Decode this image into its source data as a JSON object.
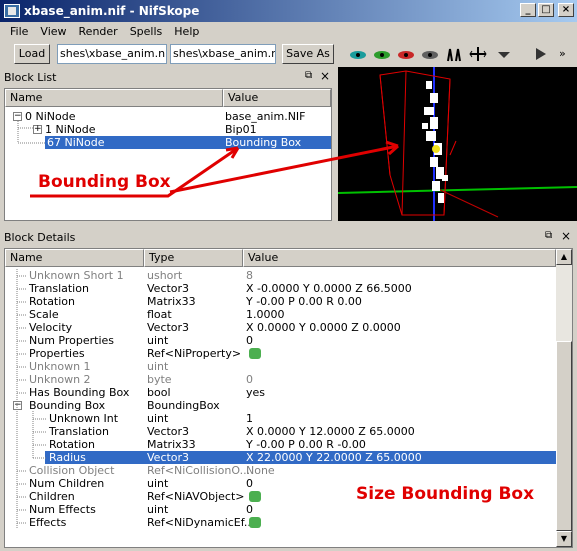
{
  "window": {
    "title": "xbase_anim.nif - NifSkope"
  },
  "menu": [
    "File",
    "View",
    "Render",
    "Spells",
    "Help"
  ],
  "toolbar": {
    "load_label": "Load",
    "load_path": "shes\\xbase_anim.nif",
    "save_path": "shes\\xbase_anim.nif",
    "save_label": "Save As"
  },
  "block_list": {
    "title": "Block List",
    "col_name": "Name",
    "col_value": "Value",
    "rows": [
      {
        "expander": "−",
        "name": "0 NiNode",
        "value": "base_anim.NIF"
      },
      {
        "expander": "+",
        "name": "1 NiNode",
        "value": "Bip01"
      },
      {
        "expander": "",
        "name": "67 NiNode",
        "value": "Bounding Box"
      }
    ]
  },
  "block_details": {
    "title": "Block Details",
    "col_name": "Name",
    "col_type": "Type",
    "col_value": "Value",
    "rows": [
      {
        "name": "Unknown Short 1",
        "type": "ushort",
        "value": "8",
        "gray": true,
        "indent": 1
      },
      {
        "name": "Translation",
        "type": "Vector3",
        "value": "X -0.0000 Y 0.0000 Z 66.5000",
        "indent": 1
      },
      {
        "name": "Rotation",
        "type": "Matrix33",
        "value": "Y -0.00 P 0.00 R 0.00",
        "indent": 1
      },
      {
        "name": "Scale",
        "type": "float",
        "value": "1.0000",
        "indent": 1
      },
      {
        "name": "Velocity",
        "type": "Vector3",
        "value": "X 0.0000 Y 0.0000 Z 0.0000",
        "indent": 1
      },
      {
        "name": "Num Properties",
        "type": "uint",
        "value": "0",
        "indent": 1
      },
      {
        "name": "Properties",
        "type": "Ref<NiProperty>",
        "value": "",
        "ref": true,
        "indent": 1
      },
      {
        "name": "Unknown 1",
        "type": "uint",
        "value": "",
        "gray": true,
        "indent": 1
      },
      {
        "name": "Unknown 2",
        "type": "byte",
        "value": "0",
        "gray": true,
        "indent": 1
      },
      {
        "name": "Has Bounding Box",
        "type": "bool",
        "value": "yes",
        "indent": 1
      },
      {
        "name": "Bounding Box",
        "type": "BoundingBox",
        "value": "",
        "indent": 1,
        "expander": "−"
      },
      {
        "name": "Unknown Int",
        "type": "uint",
        "value": "1",
        "indent": 2
      },
      {
        "name": "Translation",
        "type": "Vector3",
        "value": "X 0.0000 Y 12.0000 Z 65.0000",
        "indent": 2
      },
      {
        "name": "Rotation",
        "type": "Matrix33",
        "value": "Y -0.00 P 0.00 R -0.00",
        "indent": 2
      },
      {
        "name": "Radius",
        "type": "Vector3",
        "value": "X 22.0000 Y 22.0000 Z 65.0000",
        "indent": 2,
        "selected": true
      },
      {
        "name": "Collision Object",
        "type": "Ref<NiCollisionO...",
        "value": "None",
        "gray": true,
        "indent": 1
      },
      {
        "name": "Num Children",
        "type": "uint",
        "value": "0",
        "indent": 1
      },
      {
        "name": "Children",
        "type": "Ref<NiAVObject>",
        "value": "",
        "ref": true,
        "indent": 1
      },
      {
        "name": "Num Effects",
        "type": "uint",
        "value": "0",
        "indent": 1
      },
      {
        "name": "Effects",
        "type": "Ref<NiDynamicEf...",
        "value": "",
        "ref": true,
        "indent": 1
      }
    ]
  },
  "annotations": {
    "bounding_box": "Bounding Box",
    "size_bounding_box": "Size Bounding Box",
    "color": "#e00000"
  },
  "colors": {
    "selection": "#316ac5",
    "title_start": "#0a246a",
    "title_end": "#a6caf0"
  }
}
